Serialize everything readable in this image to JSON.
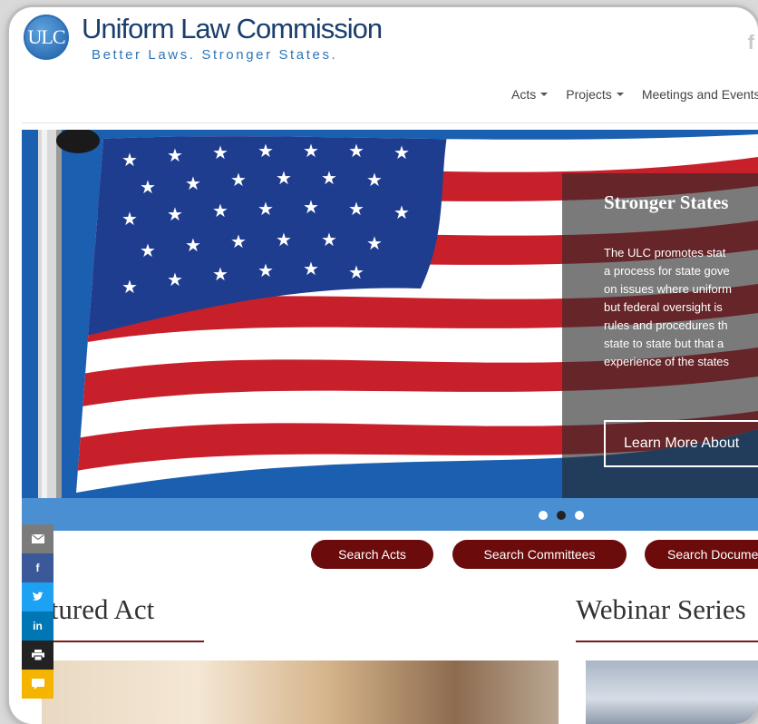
{
  "header": {
    "logo_text": "ULC",
    "title": "Uniform Law Commission",
    "tagline": "Better Laws. Stronger States.",
    "facebook_glyph": "f"
  },
  "nav": {
    "items": [
      {
        "label": "Acts",
        "has_dropdown": true
      },
      {
        "label": "Projects",
        "has_dropdown": true
      },
      {
        "label": "Meetings and Events",
        "has_dropdown": false
      }
    ]
  },
  "hero": {
    "title": "Stronger States",
    "body_lines": [
      "The ULC promotes stat",
      "a process for state gove",
      "on issues where uniform",
      "but federal oversight is",
      "rules and procedures th",
      "state to state but that a",
      "experience of the states"
    ],
    "cta_label": "Learn More About",
    "slide_count": 3,
    "active_slide": 2
  },
  "search_buttons": [
    {
      "label": "Search Acts"
    },
    {
      "label": "Search Committees"
    },
    {
      "label": "Search Documents"
    }
  ],
  "sections": {
    "featured_title": "Featured Act",
    "webinar_title": "Webinar Series"
  },
  "share_bar": {
    "items": [
      {
        "icon": "email-icon",
        "color": "#7b7b7b"
      },
      {
        "icon": "facebook-icon",
        "color": "#3b5998"
      },
      {
        "icon": "twitter-icon",
        "color": "#1da1f2"
      },
      {
        "icon": "linkedin-icon",
        "color": "#0077b5"
      },
      {
        "icon": "print-icon",
        "color": "#222222"
      },
      {
        "icon": "sms-icon",
        "color": "#f5b400"
      }
    ],
    "linkedin_label": "in"
  },
  "colors": {
    "brand_blue": "#1a3e6e",
    "accent_maroon": "#6b0b0b",
    "dots_bar": "#4a8fd2"
  }
}
